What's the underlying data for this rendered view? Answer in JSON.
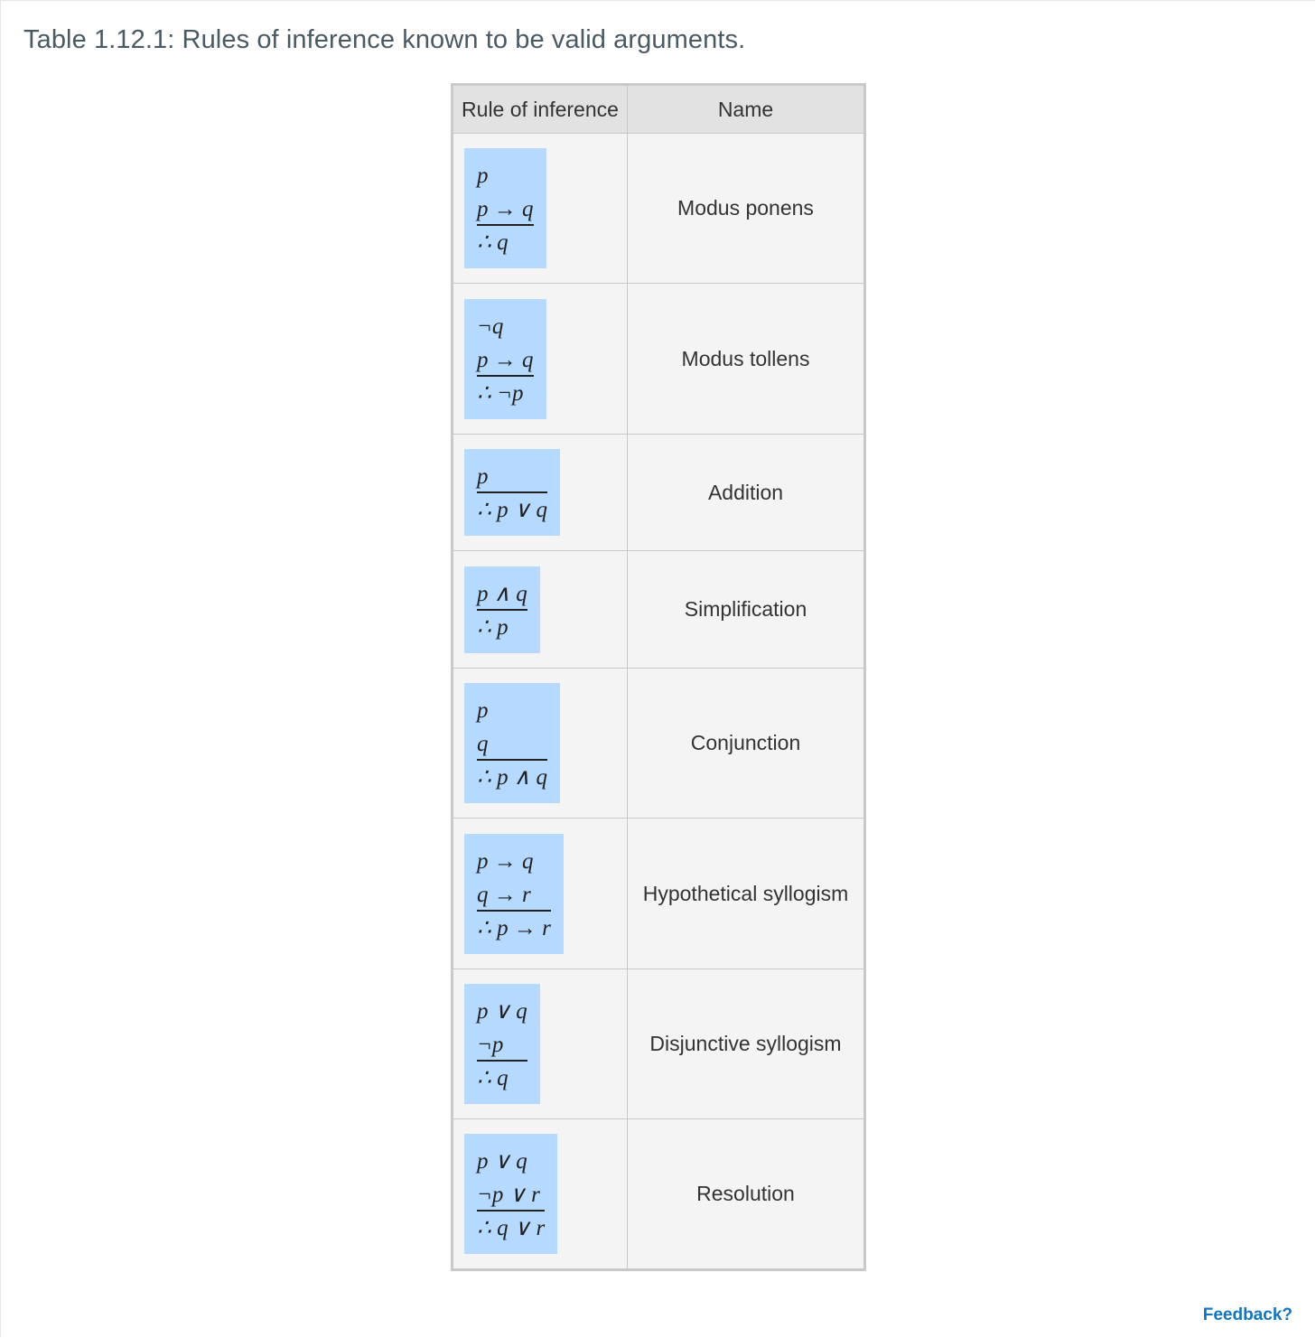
{
  "caption": "Table 1.12.1: Rules of inference known to be valid arguments.",
  "table": {
    "headers": [
      "Rule of inference",
      "Name"
    ],
    "rows": [
      {
        "premises": [
          "p",
          "p → q"
        ],
        "conclusion": "∴ q",
        "name": "Modus ponens"
      },
      {
        "premises": [
          "¬q",
          "p → q"
        ],
        "conclusion": "∴ ¬p",
        "name": "Modus tollens"
      },
      {
        "premises": [
          "p"
        ],
        "conclusion": "∴ p ∨ q",
        "name": "Addition"
      },
      {
        "premises": [
          "p ∧ q"
        ],
        "conclusion": "∴ p",
        "name": "Simplification"
      },
      {
        "premises": [
          "p",
          "q"
        ],
        "conclusion": "∴ p ∧ q",
        "name": "Conjunction"
      },
      {
        "premises": [
          "p → q",
          "q → r"
        ],
        "conclusion": "∴ p → r",
        "name": "Hypothetical syllogism"
      },
      {
        "premises": [
          "p ∨ q",
          "¬p"
        ],
        "conclusion": "∴ q",
        "name": "Disjunctive syllogism"
      },
      {
        "premises": [
          "p ∨ q",
          "¬p ∨ r"
        ],
        "conclusion": "∴ q ∨ r",
        "name": "Resolution"
      }
    ]
  },
  "feedback_label": "Feedback?"
}
